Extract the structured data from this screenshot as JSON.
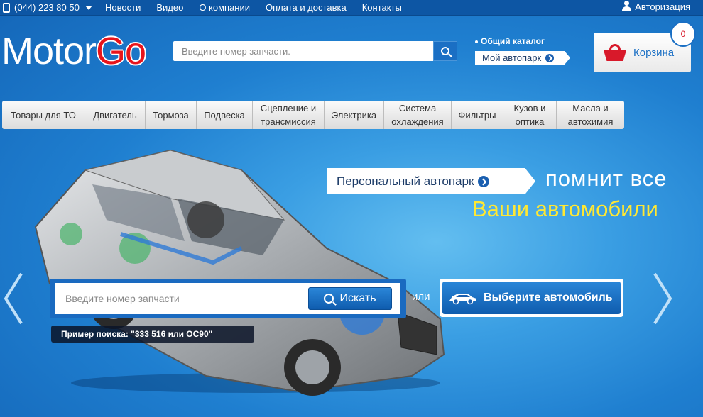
{
  "topbar": {
    "phone": "(044) 223 80 50",
    "nav": [
      "Новости",
      "Видео",
      "О компании",
      "Оплата и доставка",
      "Контакты"
    ],
    "auth": "Авторизация"
  },
  "logo": {
    "motor": "Motor",
    "go": "Go"
  },
  "header_search": {
    "placeholder": "Введите номер запчасти."
  },
  "links": {
    "catalog": "Общий каталог",
    "garage": "Мой автопарк"
  },
  "cart": {
    "label": "Корзина",
    "count": "0"
  },
  "categories": [
    "Товары для ТО",
    "Двигатель",
    "Тормоза",
    "Подвеска",
    "Сцепление и трансмиссия",
    "Электрика",
    "Система охлаждения",
    "Фильтры",
    "Кузов и оптика",
    "Масла и автохимия"
  ],
  "hero": {
    "park_button": "Персональный автопарк",
    "remember": "помнит все",
    "your_cars": "Ваши автомобили",
    "search_placeholder": "Введите номер запчасти",
    "search_button": "Искать",
    "example": "Пример поиска: \"333 516 или OC90\"",
    "or": "или",
    "choose_car": "Выберите автомобиль"
  },
  "colors": {
    "brand_red": "#e8141b",
    "accent_blue": "#1a6fc4",
    "yellow": "#ffe833"
  }
}
